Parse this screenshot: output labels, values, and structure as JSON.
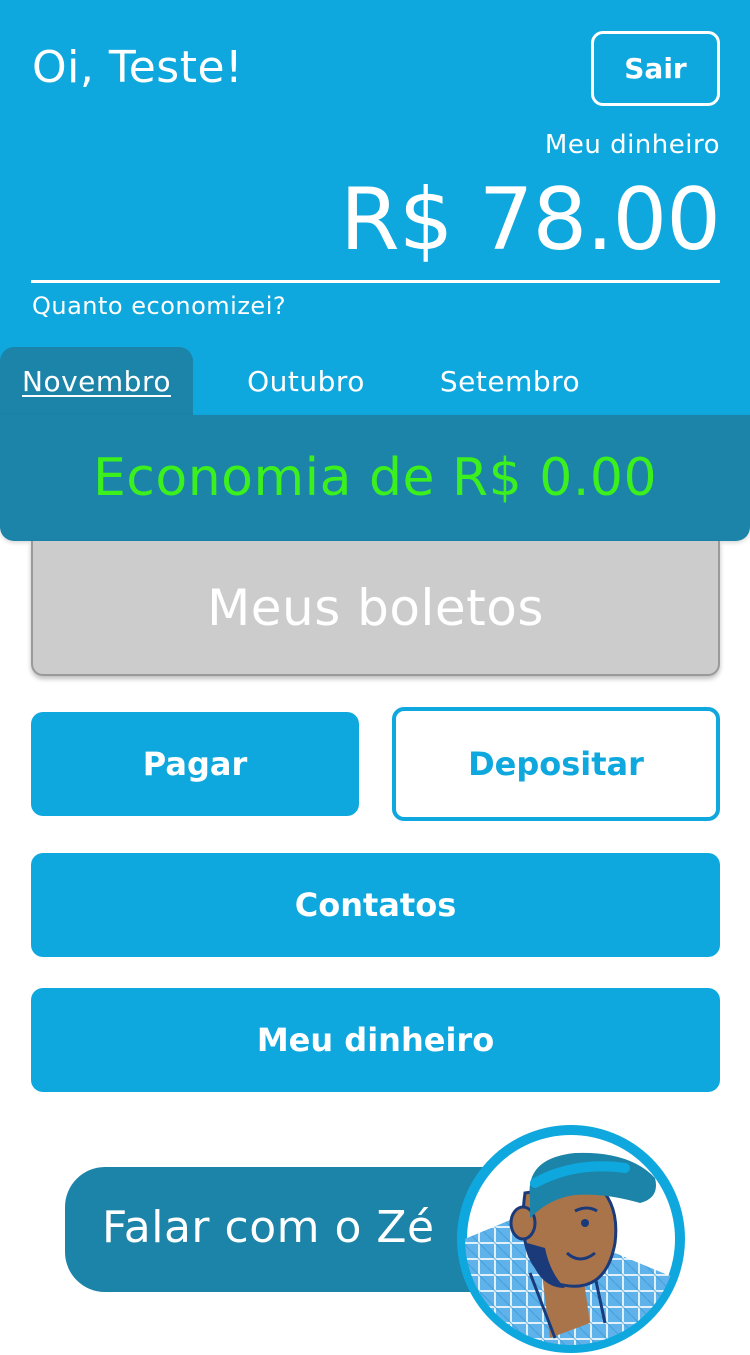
{
  "header": {
    "greeting": "Oi, Teste!",
    "logout_label": "Sair",
    "balance_label": "Meu dinheiro",
    "balance_value": "R$ 78.00",
    "savings_question": "Quanto economizei?"
  },
  "months": {
    "tabs": [
      {
        "label": "Novembro",
        "active": true
      },
      {
        "label": "Outubro",
        "active": false
      },
      {
        "label": "Setembro",
        "active": false
      }
    ]
  },
  "savings": {
    "text": "Economia de R$ 0.00",
    "color": "#3cf01e"
  },
  "boletos": {
    "label": "Meus boletos"
  },
  "actions": {
    "pay_label": "Pagar",
    "deposit_label": "Depositar",
    "contacts_label": "Contatos",
    "money_label": "Meu dinheiro"
  },
  "chat": {
    "label": "Falar com o Zé",
    "avatar_icon": "ze-avatar-icon"
  },
  "colors": {
    "primary": "#0fa8de",
    "secondary": "#1b84a8",
    "savings_green": "#3cf01e",
    "card_gray": "#cccccc"
  }
}
